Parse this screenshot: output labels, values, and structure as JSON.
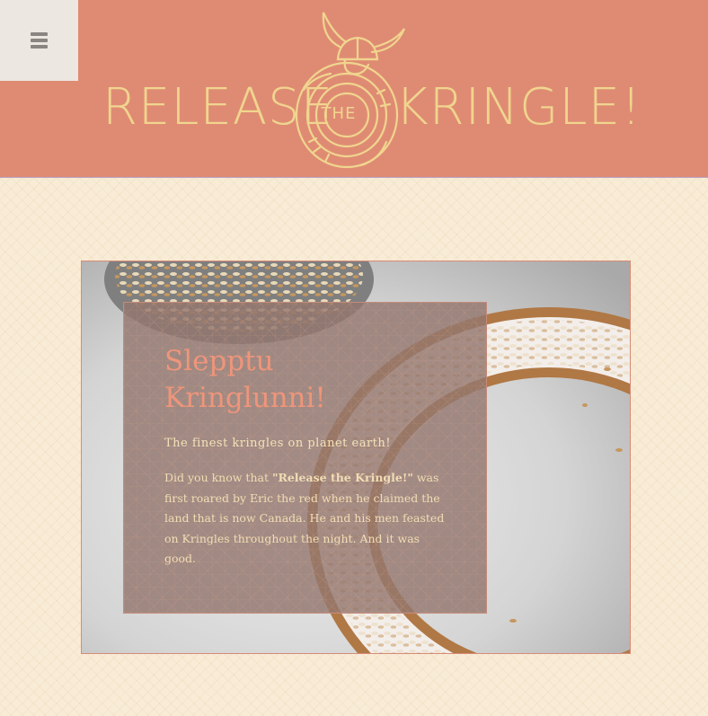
{
  "header": {
    "menu_icon": "hamburger-menu-icon",
    "logo": {
      "word_left": "RELEASE",
      "word_center": "THE",
      "word_right": "KRINGLE!",
      "emblem_icon": "viking-helmet-kringle-icon"
    },
    "colors": {
      "background": "#df8b74",
      "logo": "#f0d58e",
      "menu_bg": "#ede7e1"
    }
  },
  "hero": {
    "image_icon": "kringle-photo-image",
    "card": {
      "title": "Slepptu Kringlunni!",
      "subtitle": "The finest kringles on planet earth!",
      "body_prefix": "Did you know that ",
      "body_strong": "\"Release the Kringle!\"",
      "body_suffix": " was first roared by Eric the red when he claimed the land that is now Canada. He and his men feasted on Kringles throughout the night. And it was good."
    }
  },
  "colors": {
    "page_bg": "#f8ecd6",
    "accent": "#ef957a",
    "card_text": "#f2ddb4"
  }
}
